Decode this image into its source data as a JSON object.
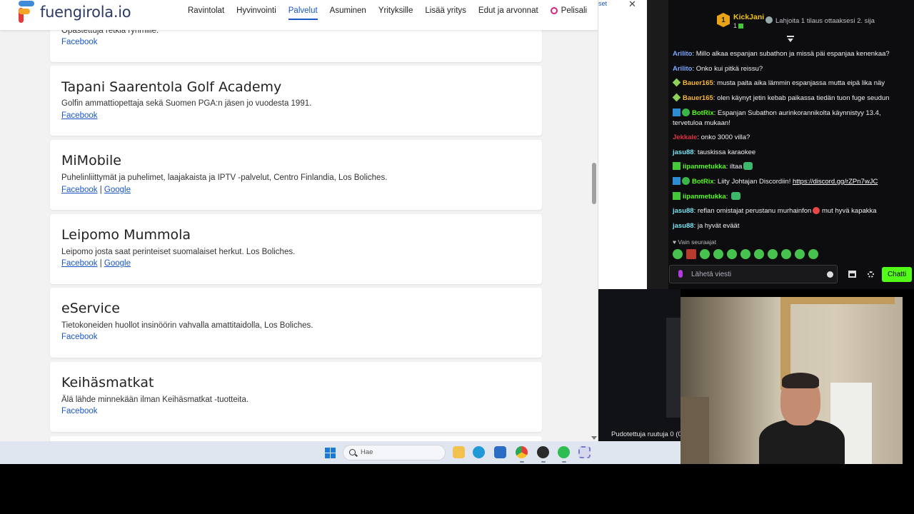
{
  "site": {
    "logo_text": "fuengirola.io",
    "nav": [
      {
        "label": "Ravintolat"
      },
      {
        "label": "Hyvinvointi"
      },
      {
        "label": "Palvelut"
      },
      {
        "label": "Asuminen"
      },
      {
        "label": "Yrityksille"
      },
      {
        "label": "Lisää yritys"
      },
      {
        "label": "Edut ja arvonnat"
      },
      {
        "label": "Pelisali"
      }
    ],
    "active_nav": "Palvelut",
    "accent_color": "#1a56c4",
    "cards": [
      {
        "desc": "Opastettuja retkiä ryhmille.",
        "links": [
          "Facebook"
        ]
      },
      {
        "title": "Tapani Saarentola Golf Academy",
        "desc": "Golfin ammattiopettaja sekä Suomen PGA:n jäsen jo vuodesta 1991.",
        "links": [
          "Facebook"
        ]
      },
      {
        "title": "MiMobile",
        "desc": "Puhelinliittymät ja puhelimet, laajakaista ja IPTV -palvelut, Centro Finlandia, Los Boliches.",
        "links": [
          "Facebook",
          "Google"
        ]
      },
      {
        "title": "Leipomo Mummola",
        "desc": "Leipomo josta saat perinteiset suomalaiset herkut. Los Boliches.",
        "links": [
          "Facebook",
          "Google"
        ]
      },
      {
        "title": "eService",
        "desc": "Tietokoneiden huollot insinöörin vahvalla amattitaidolla, Los Boliches.",
        "links": [
          "Facebook"
        ]
      },
      {
        "title": "Keihäsmatkat",
        "desc": "Älä lähde minnekään ilman Keihäsmatkat -tuotteita.",
        "links": [
          "Facebook"
        ]
      }
    ],
    "link_separator": "|"
  },
  "background_window": {
    "tab_fragment": "set",
    "close_glyph": "✕"
  },
  "status_text": "Pudotettuja ruutuja 0 (0",
  "chat": {
    "leader": {
      "rank": "1",
      "name": "KickJani",
      "count": "1"
    },
    "gift_text": "Lahjoita 1 tilaus ottaaksesi 2. sija",
    "messages": [
      {
        "user": "Arilito",
        "color": "#7aa8ff",
        "text": "Millo alkaa espanjan subathon ja missä päi espanjaa kenenkaa?"
      },
      {
        "user": "Arilito",
        "color": "#7aa8ff",
        "text": "Onko kui pitkä reissu?"
      },
      {
        "user": "Bauer165",
        "color": "#f5b731",
        "text": "musta paita aika lämmin espanjassa mutta eipä lika näy"
      },
      {
        "user": "Bauer165",
        "color": "#f5b731",
        "text": "olen käynyt jetin kebab paikassa tiedän tuon fuge seudun"
      },
      {
        "user": "BotRix",
        "color": "#53fc18",
        "text": "Espanjan Subathon aurinkorannikolta käynnistyy 13.4, tervetuloa mukaan!"
      },
      {
        "user": "Jekkale",
        "color": "#e0303f",
        "text": "onko 3000 villa?"
      },
      {
        "user": "jasu88",
        "color": "#74e3f0",
        "text": "tauskissa karaokee"
      },
      {
        "user": "iipanmetukka",
        "color": "#53fc18",
        "text": "iltaa"
      },
      {
        "user": "BotRix",
        "color": "#53fc18",
        "text": "Liity Johtajan Discordiin!",
        "link": "https://discord.gg/rZPn7wJC"
      },
      {
        "user": "iipanmetukka",
        "color": "#53fc18",
        "text": ""
      },
      {
        "user": "jasu88",
        "color": "#74e3f0",
        "text": "reflan omistajat perustanu murhainfon",
        "tail": "mut hyvä kapakka"
      },
      {
        "user": "jasu88",
        "color": "#74e3f0",
        "text": "ja hyvät eväät"
      }
    ],
    "followers_only": "Vain seuraajat",
    "input_placeholder": "Lähetä viesti",
    "send_label": "Chatti",
    "accent_color": "#53fc18"
  },
  "taskbar": {
    "search_label": "Hae",
    "icons": [
      "windows-start-icon",
      "file-explorer-icon",
      "edge-icon",
      "microsoft-store-icon",
      "chrome-icon",
      "obs-icon",
      "whatsapp-icon",
      "snipping-tool-icon"
    ]
  }
}
